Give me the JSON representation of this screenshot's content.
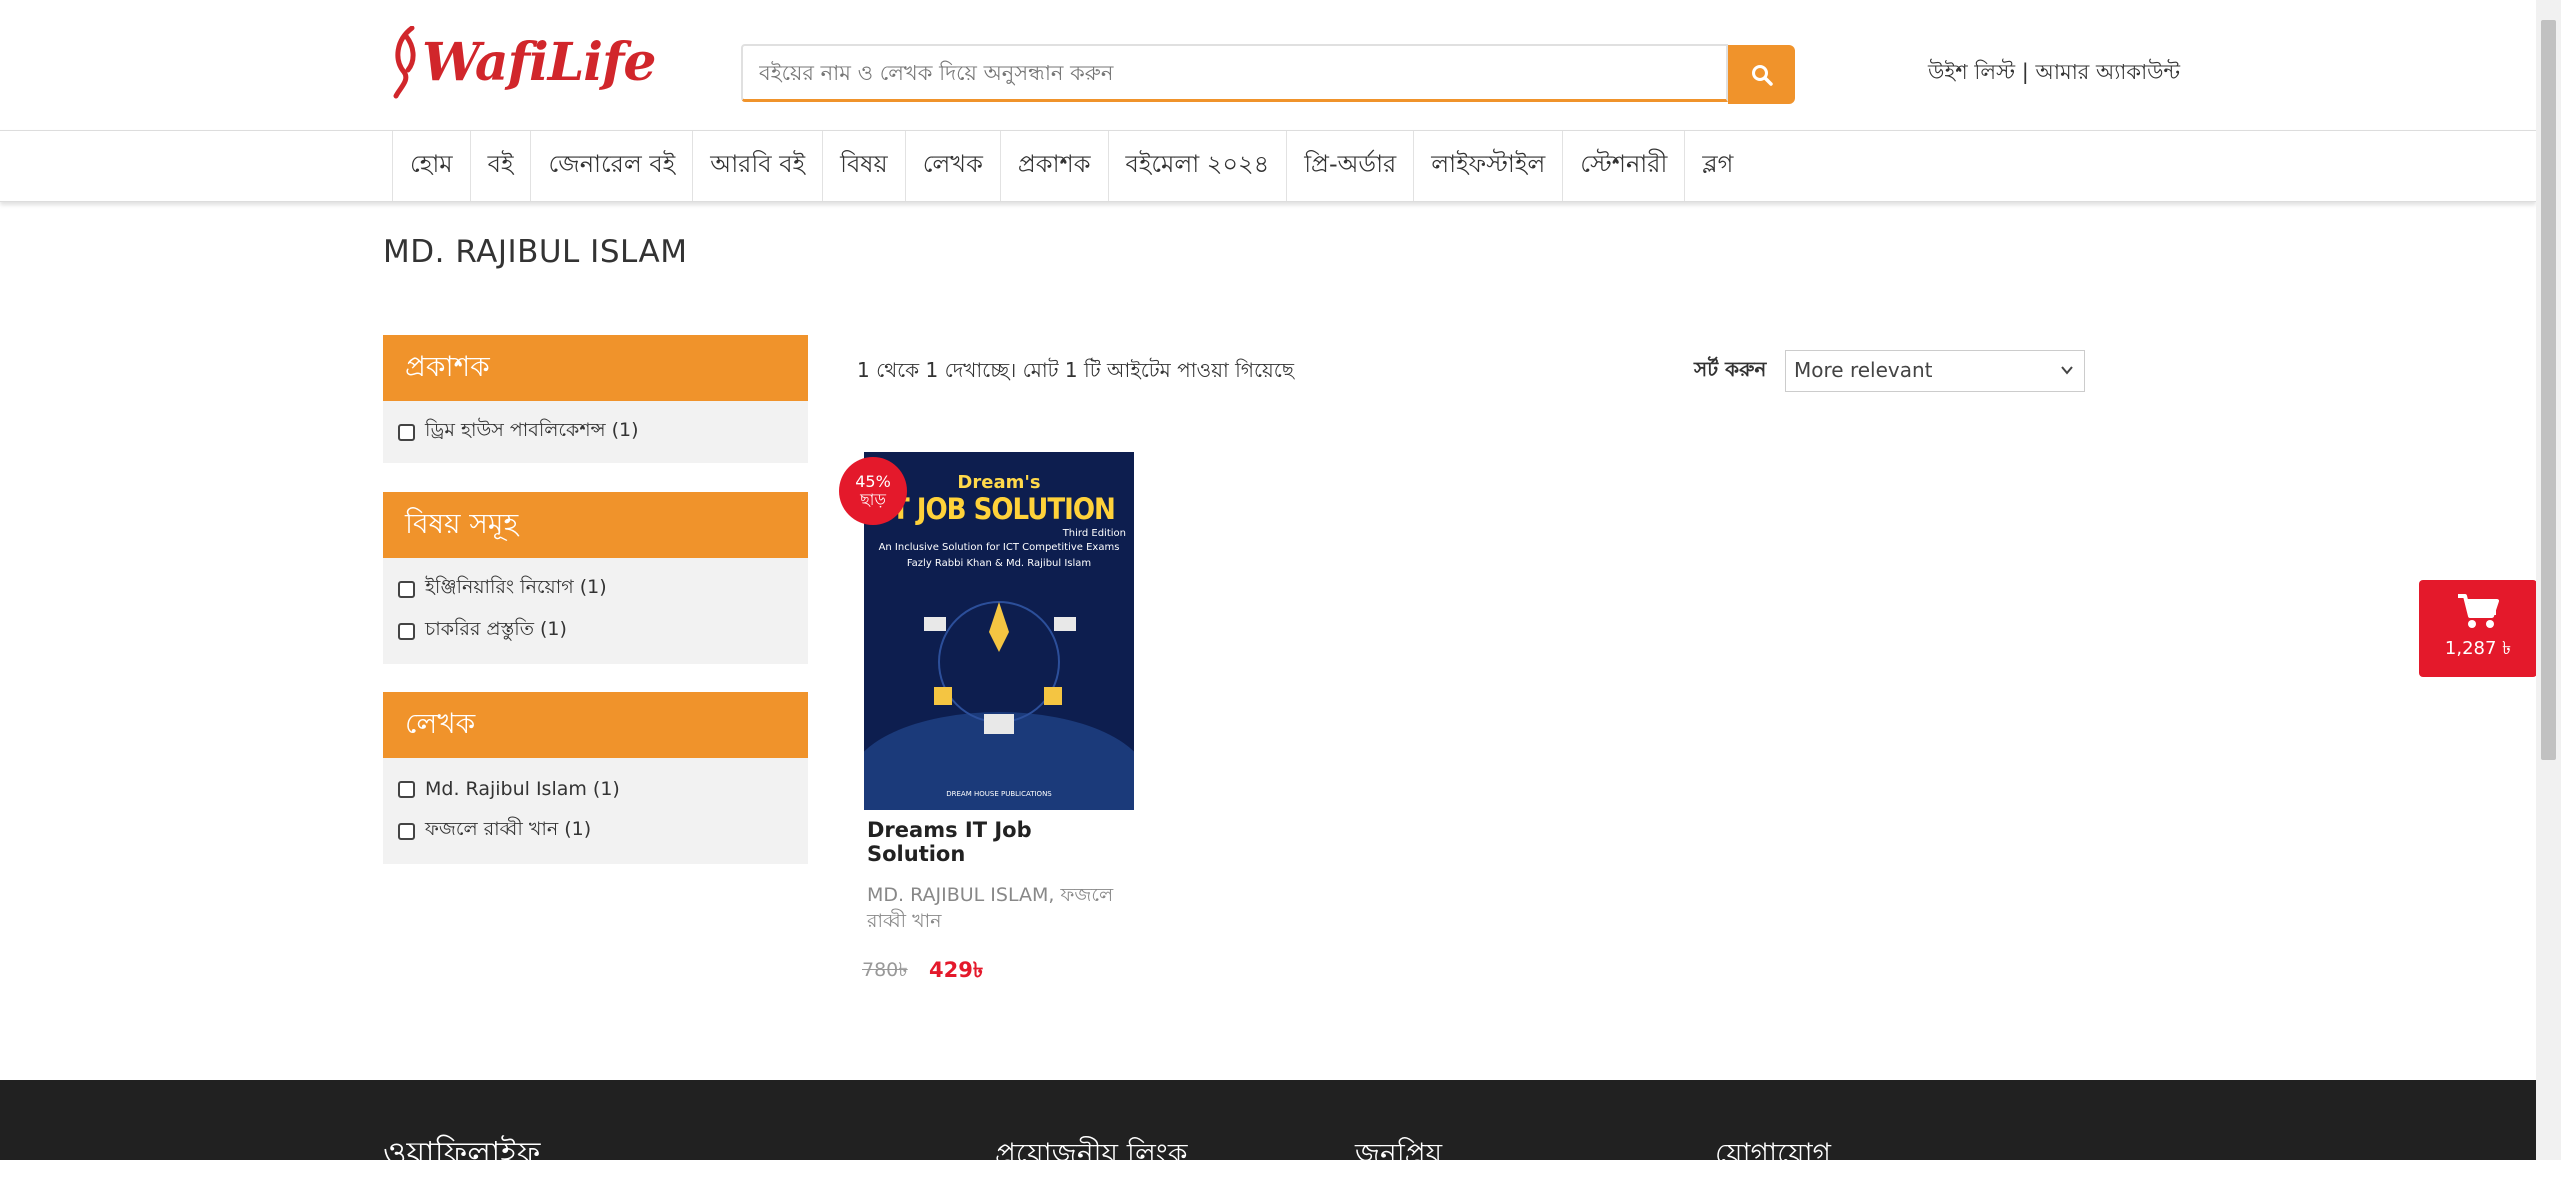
{
  "header": {
    "logo_text": "WafiLife",
    "search_placeholder": "বইয়ের নাম ও লেখক দিয়ে অনুসন্ধান করুন",
    "wishlist": "উইশ লিস্ট",
    "separator": " | ",
    "account": "আমার অ্যাকাউন্ট"
  },
  "nav": {
    "items": [
      "হোম",
      "বই",
      "জেনারেল বই",
      "আরবি বই",
      "বিষয়",
      "লেখক",
      "প্রকাশক",
      "বইমেলা ২০২৪",
      "প্রি-অর্ডার",
      "লাইফস্টাইল",
      "স্টেশনারী",
      "ব্লগ"
    ]
  },
  "page": {
    "title": "MD. RAJIBUL ISLAM"
  },
  "filters": {
    "publisher": {
      "heading": "প্রকাশক",
      "items": [
        "ড্রিম হাউস পাবলিকেশন্স (1)"
      ]
    },
    "subjects": {
      "heading": "বিষয় সমূহ",
      "items": [
        "ইঞ্জিনিয়ারিং নিয়োগ (1)",
        "চাকরির প্রস্তুতি (1)"
      ]
    },
    "authors": {
      "heading": "লেখক",
      "items": [
        "Md. Rajibul Islam (1)",
        "ফজলে রাব্বী খান (1)"
      ]
    }
  },
  "results": {
    "info": "1 থেকে 1 দেখাচ্ছে। মোট 1 টি আইটেম পাওয়া গিয়েছে",
    "sort_label": "সর্ট করুন",
    "sort_value": "More relevant"
  },
  "product": {
    "discount": "45%",
    "discount_label": "ছাড়",
    "cover_brand": "Dream's",
    "cover_title": "IT JOB SOLUTION",
    "cover_edition": "Third Edition",
    "cover_subtitle": "An Inclusive Solution for ICT Competitive Exams",
    "cover_authors": "Fazly Rabbi Khan & Md. Rajibul Islam",
    "cover_publisher": "DREAM HOUSE PUBLICATIONS",
    "title": "Dreams IT Job Solution",
    "author": "MD. RAJIBUL ISLAM, ফজলে রাব্বী খান",
    "old_price": "780৳",
    "new_price": "429৳"
  },
  "cart": {
    "amount": "1,287 ৳"
  },
  "footer": {
    "logo": "ওয়াফিলাইফ",
    "col1": "প্রয়োজনীয় লিংক",
    "col2": "জনপ্রিয়",
    "col3": "যোগাযোগ"
  },
  "colors": {
    "accent": "#f0932b",
    "brand_red": "#d1262b",
    "sale_red": "#e4192b",
    "footer_bg": "#212121"
  }
}
